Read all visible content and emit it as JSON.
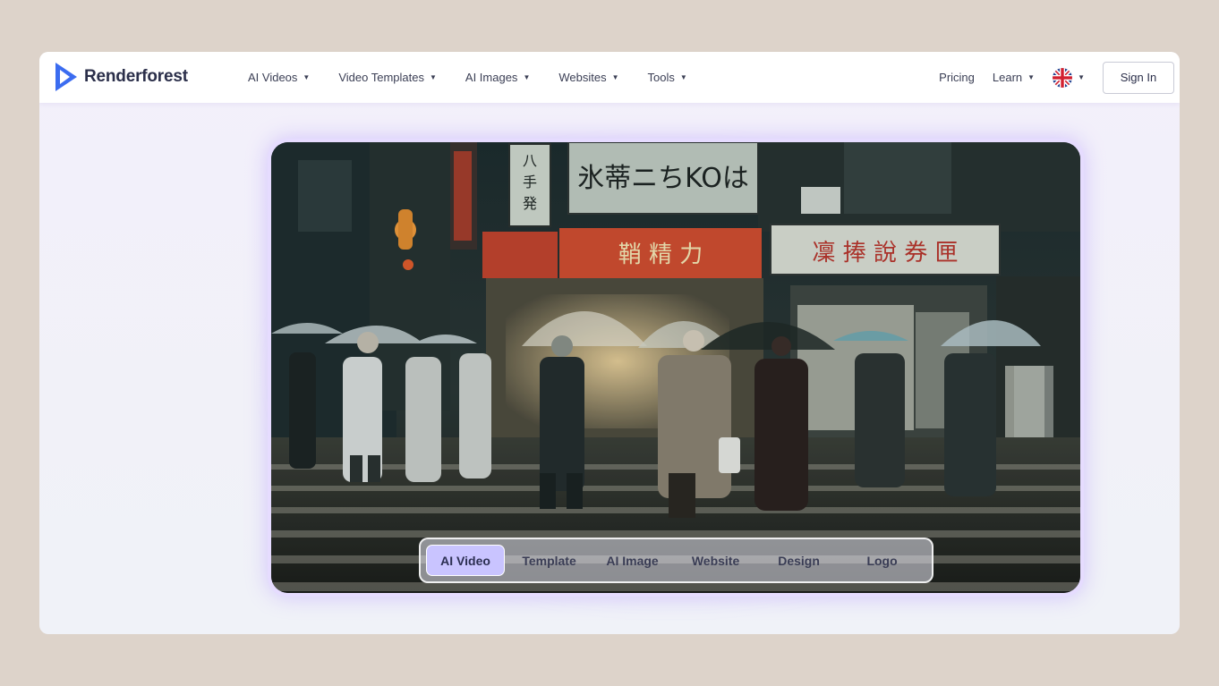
{
  "brand": {
    "name": "Renderforest"
  },
  "nav": {
    "items": [
      {
        "label": "AI Videos"
      },
      {
        "label": "Video Templates"
      },
      {
        "label": "AI Images"
      },
      {
        "label": "Websites"
      },
      {
        "label": "Tools"
      }
    ],
    "pricing": "Pricing",
    "learn": "Learn",
    "signin": "Sign In"
  },
  "hero": {
    "signs": {
      "top": "氷蒂ニちKOは",
      "vertical": "八手発",
      "red_left": "鞘 精 力",
      "red_right": "凜 捧 說 券 匣"
    }
  },
  "tabs": [
    {
      "label": "AI Video",
      "active": true
    },
    {
      "label": "Template",
      "active": false
    },
    {
      "label": "AI Image",
      "active": false
    },
    {
      "label": "Website",
      "active": false
    },
    {
      "label": "Design",
      "active": false
    },
    {
      "label": "Logo",
      "active": false
    }
  ],
  "colors": {
    "accent": "#3b6cf0",
    "active_tab": "#c9c4ff",
    "background": "#ddd3ca"
  }
}
